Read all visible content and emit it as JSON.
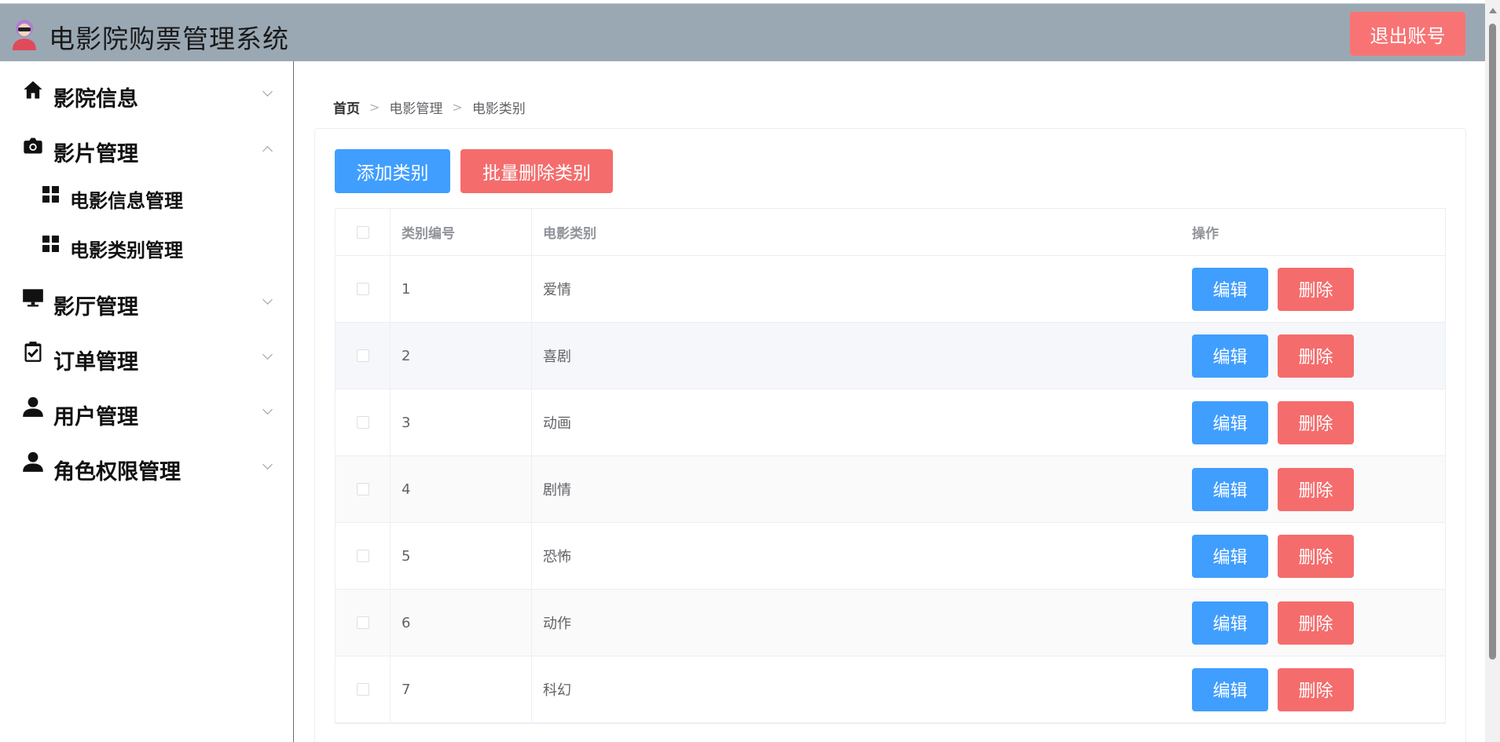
{
  "header": {
    "title": "电影院购票管理系统",
    "logout_label": "退出账号"
  },
  "sidebar": {
    "menus": [
      {
        "label": "影院信息",
        "icon": "home-icon",
        "expanded": false
      },
      {
        "label": "影片管理",
        "icon": "camera-icon",
        "expanded": true
      },
      {
        "label": "影厅管理",
        "icon": "monitor-icon",
        "expanded": false
      },
      {
        "label": "订单管理",
        "icon": "clipboard-check-icon",
        "expanded": false
      },
      {
        "label": "用户管理",
        "icon": "user-icon",
        "expanded": false
      },
      {
        "label": "角色权限管理",
        "icon": "user-icon",
        "expanded": false
      }
    ],
    "submenus": [
      {
        "label": "电影信息管理",
        "icon": "grid-icon"
      },
      {
        "label": "电影类别管理",
        "icon": "grid-icon"
      }
    ]
  },
  "breadcrumb": [
    "首页",
    "电影管理",
    "电影类别"
  ],
  "toolbar": {
    "add_label": "添加类别",
    "batch_delete_label": "批量删除类别"
  },
  "table": {
    "headers": {
      "id": "类别编号",
      "type": "电影类别",
      "ops": "操作"
    },
    "edit_label": "编辑",
    "delete_label": "删除",
    "rows": [
      {
        "id": "1",
        "type": "爱情"
      },
      {
        "id": "2",
        "type": "喜剧"
      },
      {
        "id": "3",
        "type": "动画"
      },
      {
        "id": "4",
        "type": "剧情"
      },
      {
        "id": "5",
        "type": "恐怖"
      },
      {
        "id": "6",
        "type": "动作"
      },
      {
        "id": "7",
        "type": "科幻"
      }
    ]
  },
  "colors": {
    "header_bg": "#9aa8b3",
    "primary": "#409eff",
    "danger": "#f56c6c",
    "logout": "#f87474"
  }
}
